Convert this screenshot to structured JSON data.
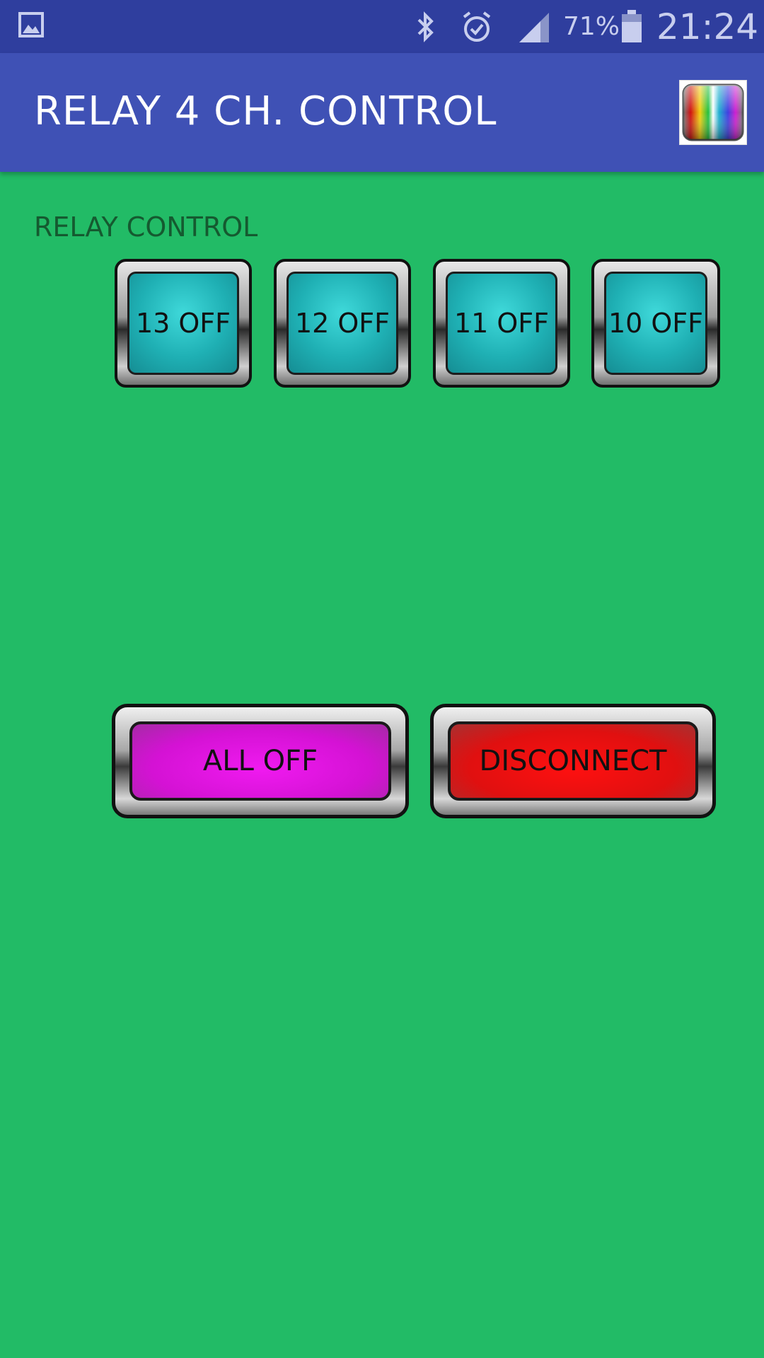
{
  "status_bar": {
    "left_icon": "image-icon",
    "bluetooth_icon": "bluetooth-icon",
    "alarm_icon": "alarm-icon",
    "signal_icon": "signal-icon",
    "battery_percent": "71%",
    "battery_icon": "battery-icon",
    "time": "21:24"
  },
  "app_bar": {
    "title": "RELAY 4 CH. CONTROL",
    "app_icon": "rainbow-stripes-icon"
  },
  "section_label": "RELAY CONTROL",
  "relays": [
    {
      "label": "13 OFF"
    },
    {
      "label": "12 OFF"
    },
    {
      "label": "11 OFF"
    },
    {
      "label": "10 OFF"
    }
  ],
  "actions": {
    "all_off": "ALL OFF",
    "disconnect": "DISCONNECT"
  },
  "colors": {
    "background": "#22bb66",
    "status_bar": "#2f3e9e",
    "app_bar": "#3f51b5",
    "relay_face": "#1fb0b4",
    "all_off_face": "#d412d4",
    "disconnect_face": "#e01010"
  }
}
